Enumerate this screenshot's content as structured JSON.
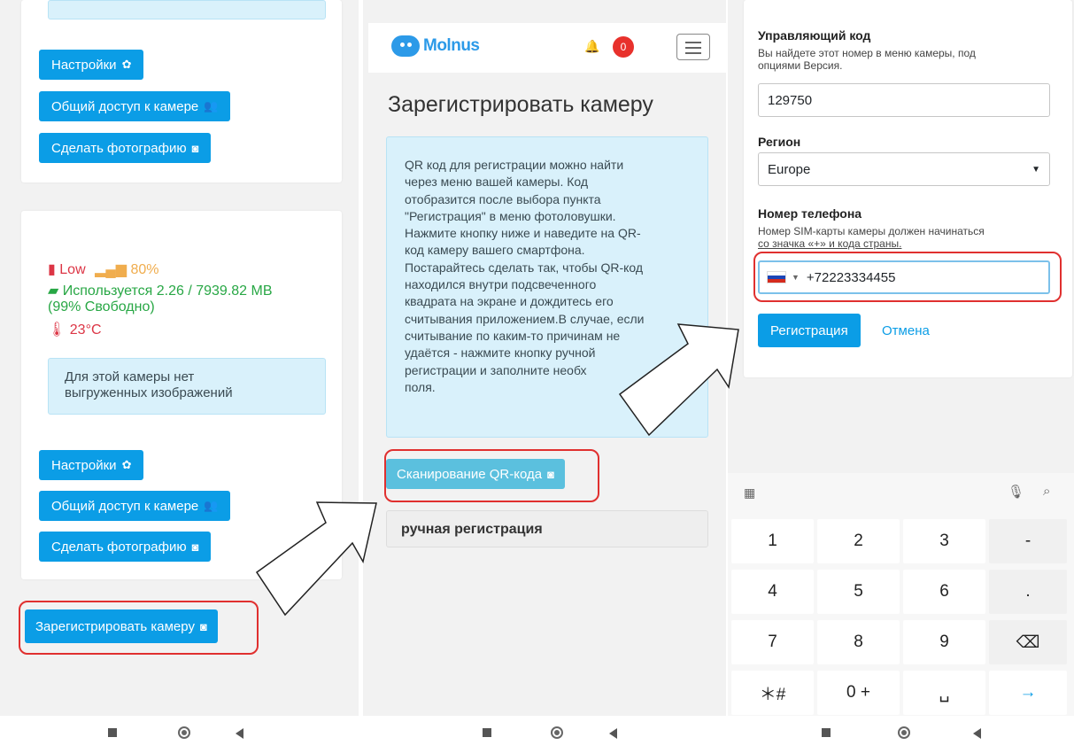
{
  "panel1": {
    "settings_label": "Настройки",
    "share_label": "Общий доступ к камере",
    "photo_label": "Сделать фотографию",
    "battery_label": "Low",
    "signal_pct": "80%",
    "storage_line1": "Используется 2.26 / 7939.82 MB",
    "storage_line2": "(99% Свободно)",
    "temperature": "23°C",
    "no_images_line1": "Для этой камеры нет",
    "no_images_line2": "выгруженных изображений",
    "register_label": "Зарегистрировать камеру"
  },
  "panel2": {
    "logo": "Molnus",
    "notif_count": "0",
    "title": "Зарегистрировать камеру",
    "info_lines": [
      "QR код для регистрации можно найти",
      "через меню вашей камеры. Код",
      "отобразится после выбора пункта",
      "\"Регистрация\" в меню фотоловушки.",
      "Нажмите кнопку ниже и наведите на QR-",
      "код камеру вашего смартфона.",
      "Постарайтесь сделать так, чтобы QR-код",
      "находился внутри подсвеченного",
      "квадрата на экране и дождитесь его",
      "считывания приложением.В случае, если",
      "считывание по каким-то причинам не",
      "удаётся - нажмите кнопку ручной",
      "регистрации и заполните необх",
      "поля."
    ],
    "scan_label": "Сканирование QR-кода",
    "manual_label": "ручная регистрация"
  },
  "panel3": {
    "control_code_label": "Управляющий код",
    "control_code_hint1": "Вы найдете этот номер в меню камеры, под",
    "control_code_hint2": "опциями Версия.",
    "control_code_value": "129750",
    "region_label": "Регион",
    "region_value": "Europe",
    "phone_label": "Номер телефона",
    "phone_hint1": "Номер SIM-карты камеры должен начинаться",
    "phone_hint2": "со значка «+» и кода страны.",
    "phone_value": "+72223334455",
    "register_label": "Регистрация",
    "cancel_label": "Отмена",
    "keys": [
      {
        "name": "key-1",
        "label": "1"
      },
      {
        "name": "key-2",
        "label": "2"
      },
      {
        "name": "key-3",
        "label": "3"
      },
      {
        "name": "key-minus",
        "label": "-"
      },
      {
        "name": "key-4",
        "label": "4"
      },
      {
        "name": "key-5",
        "label": "5"
      },
      {
        "name": "key-6",
        "label": "6"
      },
      {
        "name": "key-dot",
        "label": "."
      },
      {
        "name": "key-7",
        "label": "7"
      },
      {
        "name": "key-8",
        "label": "8"
      },
      {
        "name": "key-9",
        "label": "9"
      },
      {
        "name": "key-backspace",
        "label": "⌫"
      },
      {
        "name": "key-star-hash",
        "label": "＊#"
      },
      {
        "name": "key-0-plus",
        "label": "0 +"
      },
      {
        "name": "key-space",
        "label": "␣"
      },
      {
        "name": "key-enter",
        "label": "→"
      }
    ]
  },
  "colors": {
    "primary": "#0b9de6",
    "scan_button": "#5bc0de",
    "highlight_red": "#e0302f",
    "battery_red": "#dc3545",
    "signal_orange": "#f0ad4e",
    "storage_green": "#28a745"
  }
}
